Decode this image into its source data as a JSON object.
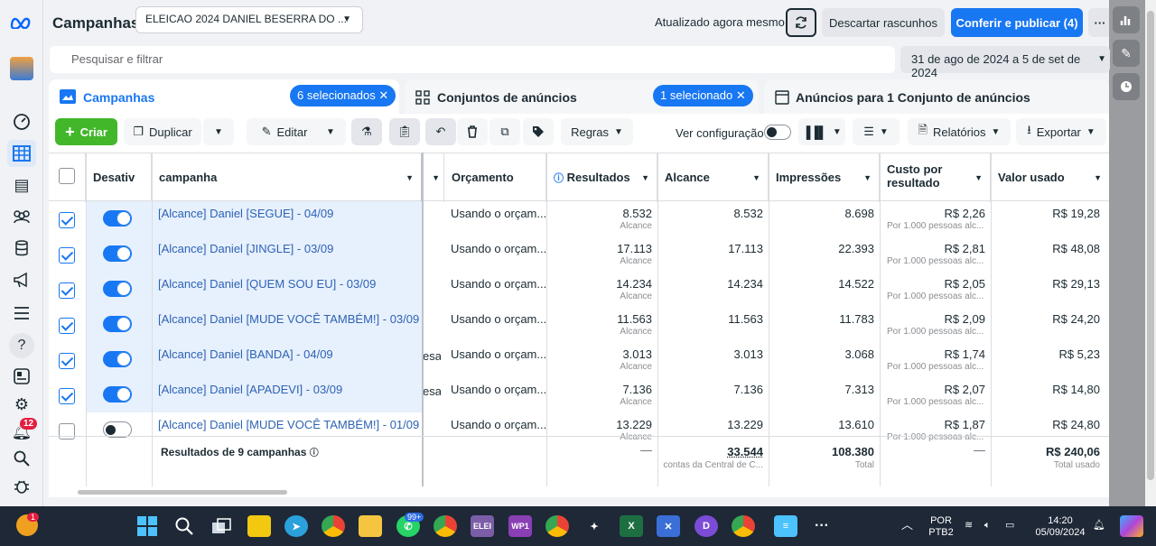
{
  "header": {
    "title": "Campanhas",
    "account": "ELEICAO 2024 DANIEL BESERRA DO ...",
    "updated": "Atualizado agora mesmo",
    "discard": "Descartar rascunhos",
    "publish": "Conferir e publicar (4)",
    "more": "···"
  },
  "search": {
    "placeholder": "Pesquisar e filtrar"
  },
  "daterange": "31 de ago de 2024 a 5 de set de 2024",
  "tabs": {
    "campaigns": {
      "label": "Campanhas",
      "pill": "6 selecionados ✕"
    },
    "adsets": {
      "label": "Conjuntos de anúncios",
      "pill": "1 selecionado ✕"
    },
    "ads": {
      "label": "Anúncios para 1 Conjunto de anúncios"
    }
  },
  "toolbar": {
    "create": "Criar",
    "duplicate": "Duplicar",
    "edit": "Editar",
    "rules": "Regras",
    "view_config": "Ver configuração",
    "reports": "Relatórios",
    "export": "Exportar"
  },
  "columns": {
    "off": "Desativ",
    "campaign": "campanha",
    "budget": "Orçamento",
    "results": "Resultados",
    "reach": "Alcance",
    "impressions": "Impressões",
    "cost": "Custo por resultado",
    "spent": "Valor usado"
  },
  "rows": [
    {
      "name": "[Alcance] Daniel [SEGUE] - 04/09",
      "budget": "Usando o orçam...",
      "results": "8.532",
      "results_sub": "Alcance",
      "reach": "8.532",
      "impr": "8.698",
      "cost": "R$ 2,26",
      "cost_sub": "Por 1.000 pessoas alc...",
      "spent": "R$ 19,28",
      "stub": ""
    },
    {
      "name": "[Alcance] Daniel [JINGLE] - 03/09",
      "budget": "Usando o orçam...",
      "results": "17.113",
      "results_sub": "Alcance",
      "reach": "17.113",
      "impr": "22.393",
      "cost": "R$ 2,81",
      "cost_sub": "Por 1.000 pessoas alc...",
      "spent": "R$ 48,08",
      "stub": ""
    },
    {
      "name": "[Alcance] Daniel [QUEM SOU EU] - 03/09",
      "budget": "Usando o orçam...",
      "results": "14.234",
      "results_sub": "Alcance",
      "reach": "14.234",
      "impr": "14.522",
      "cost": "R$ 2,05",
      "cost_sub": "Por 1.000 pessoas alc...",
      "spent": "R$ 29,13",
      "stub": ""
    },
    {
      "name": "[Alcance] Daniel [MUDE VOCÊ TAMBÉM!] - 03/09",
      "budget": "Usando o orçam...",
      "results": "11.563",
      "results_sub": "Alcance",
      "reach": "11.563",
      "impr": "11.783",
      "cost": "R$ 2,09",
      "cost_sub": "Por 1.000 pessoas alc...",
      "spent": "R$ 24,20",
      "stub": ""
    },
    {
      "name": "[Alcance] Daniel [BANDA] - 04/09",
      "budget": "Usando o orçam...",
      "results": "3.013",
      "results_sub": "Alcance",
      "reach": "3.013",
      "impr": "3.068",
      "cost": "R$ 1,74",
      "cost_sub": "Por 1.000 pessoas alc...",
      "spent": "R$ 5,23",
      "stub": "esa"
    },
    {
      "name": "[Alcance] Daniel [APADEVI] - 03/09",
      "budget": "Usando o orçam...",
      "results": "7.136",
      "results_sub": "Alcance",
      "reach": "7.136",
      "impr": "7.313",
      "cost": "R$ 2,07",
      "cost_sub": "Por 1.000 pessoas alc...",
      "spent": "R$ 14,80",
      "stub": "esa"
    },
    {
      "name": "[Alcance] Daniel [MUDE VOCÊ TAMBÉM!] - 01/09",
      "budget": "Usando o orçam...",
      "results": "13.229",
      "results_sub": "Alcance",
      "reach": "13.229",
      "impr": "13.610",
      "cost": "R$ 1,87",
      "cost_sub": "Por 1.000 pessoas alc...",
      "spent": "R$ 24,80",
      "stub": ""
    }
  ],
  "footer": {
    "label": "Resultados de 9 campanhas",
    "results": "—",
    "reach": "33.544",
    "reach_sub": "contas da Central de C...",
    "impr": "108.380",
    "impr_sub": "Total",
    "cost": "—",
    "spent": "R$ 240,06",
    "spent_sub": "Total usado"
  },
  "rail": {
    "notif_badge": "12"
  },
  "taskbar": {
    "lang1": "POR",
    "lang2": "PTB2",
    "time": "14:20",
    "date": "05/09/2024",
    "whatsapp_badge": "99+",
    "app1": "ELEI",
    "app2": "WP1",
    "weather_badge": "1"
  }
}
